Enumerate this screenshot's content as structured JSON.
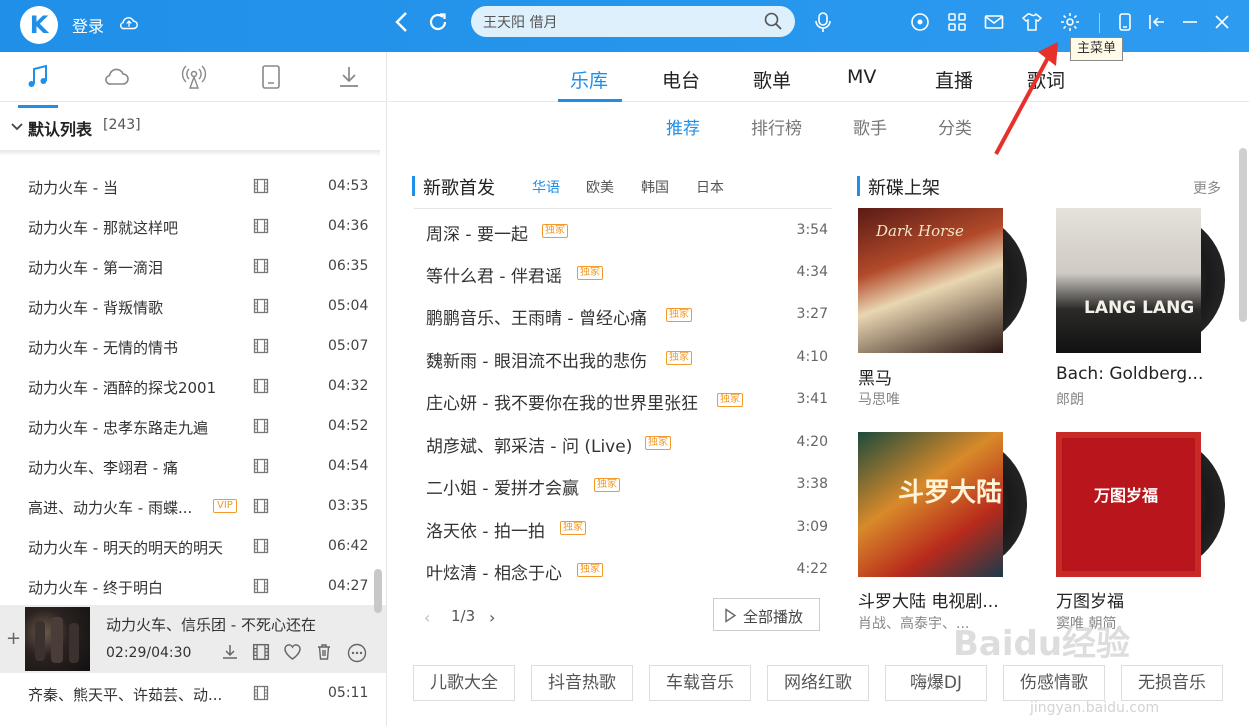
{
  "header": {
    "logo_letter": "K",
    "login_label": "登录",
    "search_value": "王天阳 借月",
    "tooltip": "主菜单"
  },
  "left_panel": {
    "playlist_name": "默认列表",
    "playlist_count": "[243]",
    "songs": [
      {
        "title": "动力火车 - 当",
        "duration": "04:53"
      },
      {
        "title": "动力火车 - 那就这样吧",
        "duration": "04:36"
      },
      {
        "title": "动力火车 - 第一滴泪",
        "duration": "06:35"
      },
      {
        "title": "动力火车 - 背叛情歌",
        "duration": "05:04"
      },
      {
        "title": "动力火车 - 无情的情书",
        "duration": "05:07"
      },
      {
        "title": "动力火车 - 酒醉的探戈2001",
        "duration": "04:32"
      },
      {
        "title": "动力火车 - 忠孝东路走九遍",
        "duration": "04:52"
      },
      {
        "title": "动力火车、李翊君 - 痛",
        "duration": "04:54"
      },
      {
        "title": "高进、动力火车 - 雨蝶...",
        "duration": "03:35",
        "vip": "VIP"
      },
      {
        "title": "动力火车 - 明天的明天的明天",
        "duration": "06:42"
      },
      {
        "title": "动力火车 - 终于明白",
        "duration": "04:27"
      }
    ],
    "now_playing": {
      "title": "动力火车、信乐团 - 不死心还在",
      "time": "02:29/04:30"
    },
    "last_song": {
      "title": "齐秦、熊天平、许茹芸、动...",
      "duration": "05:11"
    }
  },
  "main_tabs": [
    "乐库",
    "电台",
    "歌单",
    "MV",
    "直播",
    "歌词"
  ],
  "sub_tabs": [
    "推荐",
    "排行榜",
    "歌手",
    "分类"
  ],
  "new_songs": {
    "title": "新歌首发",
    "langs": [
      "华语",
      "欧美",
      "韩国",
      "日本"
    ],
    "badge": "独家",
    "songs": [
      {
        "title": "周深 - 要一起",
        "duration": "3:54"
      },
      {
        "title": "等什么君 - 伴君谣",
        "duration": "4:34"
      },
      {
        "title": "鹏鹏音乐、王雨晴 - 曾经心痛",
        "duration": "3:27"
      },
      {
        "title": "魏新雨 - 眼泪流不出我的悲伤",
        "duration": "4:10"
      },
      {
        "title": "庄心妍 - 我不要你在我的世界里张狂",
        "duration": "3:41"
      },
      {
        "title": "胡彦斌、郭采洁 - 问 (Live)",
        "duration": "4:20"
      },
      {
        "title": "二小姐 - 爱拼才会赢",
        "duration": "3:38"
      },
      {
        "title": "洛天依 - 拍一拍",
        "duration": "3:09"
      },
      {
        "title": "叶炫清 - 相念于心",
        "duration": "4:22"
      }
    ],
    "pager": "1/3",
    "play_all": "全部播放"
  },
  "new_albums": {
    "title": "新碟上架",
    "more": "更多",
    "albums": [
      {
        "title": "黑马",
        "artist": "马思唯",
        "cover_text": "Dark Horse"
      },
      {
        "title": "Bach: Goldberg...",
        "artist": "郎朗",
        "cover_text": "LANG LANG"
      },
      {
        "title": "斗罗大陆 电视剧...",
        "artist": "肖战、高泰宇、...",
        "cover_text": "斗罗大陆"
      },
      {
        "title": "万图岁福",
        "artist": "窦唯 朝简",
        "cover_text": "万图岁福"
      }
    ]
  },
  "tags": [
    "儿歌大全",
    "抖音热歌",
    "车载音乐",
    "网络红歌",
    "嗨爆DJ",
    "伤感情歌",
    "无损音乐"
  ],
  "watermark": "Baidu经验",
  "watermark_url": "jingyan.baidu.com",
  "colors": {
    "accent": "#1f8fe8",
    "badge": "#f39a2b",
    "arrow": "#e8302a"
  }
}
